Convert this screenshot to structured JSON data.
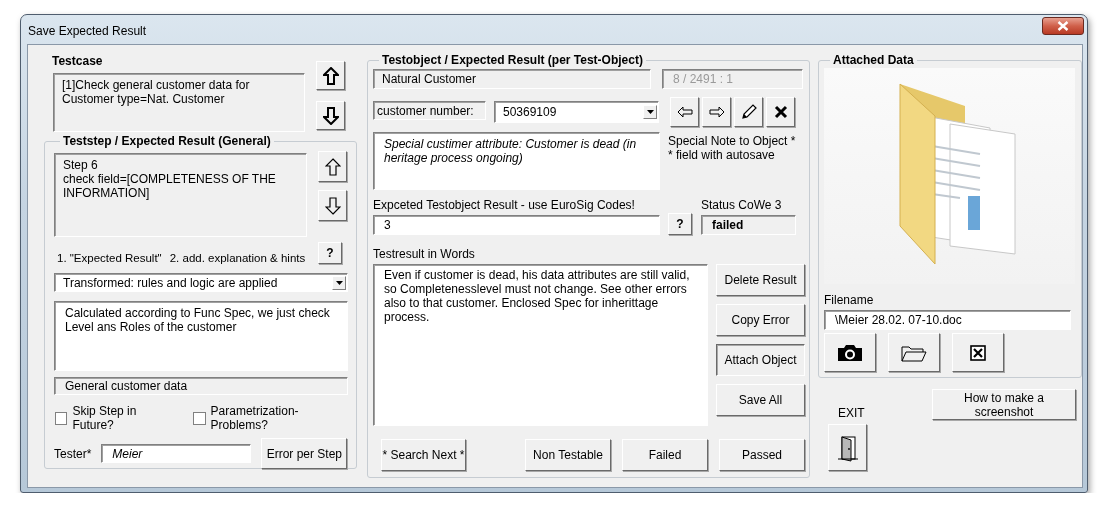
{
  "window": {
    "title": "Save Expected Result"
  },
  "testcase": {
    "label": "Testcase",
    "text": "[1]Check general customer data for Customer type=Nat. Customer"
  },
  "teststep": {
    "label": "Teststep / Expected Result (General)",
    "text": "Step 6\ncheck field=[COMPLETENESS OF THE INFORMATION]",
    "hints": [
      "1.  \"Expected Result\"",
      "2. add. explanation & hints"
    ],
    "help_button": "?",
    "category": "Transformed: rules and logic are applied",
    "explanation": "Calculated according to Func Spec, we just check Level ans Roles of the customer",
    "group": "General customer data",
    "checkboxes": [
      {
        "label": "Skip Step in Future?",
        "checked": false
      },
      {
        "label": "Parametrization-Problems?",
        "checked": false
      }
    ],
    "tester_label": "Tester*",
    "tester": "Meier",
    "error_button": "Error per Step"
  },
  "testobject": {
    "label": "Testobject  / Expected Result (per Test-Object)",
    "type": "Natural Customer",
    "position": {
      "text": "8 / 2491 : 1",
      "disabled": true
    },
    "key_label": "customer number:",
    "key_value": "50369109",
    "note": "Special custimer attribute: Customer is dead (in heritage process ongoing)",
    "note_hints": [
      "Special Note to Object *",
      "* field with autosave"
    ],
    "expected_label": "Expceted Testobject Result - use EuroSig Codes!",
    "expected": "3",
    "help_button": "?",
    "status_label": "Status CoWe 3",
    "status": "failed",
    "words_label": "Testresult in Words",
    "words": "Even if customer is dead, his data attributes are still valid, so Completenesslevel must not change. See other errors also to that customer. Enclosed Spec for inherittage process.",
    "side_buttons": [
      {
        "label": "Delete Result",
        "pressed": false
      },
      {
        "label": "Copy Error",
        "pressed": false
      },
      {
        "label": "Attach Object",
        "pressed": true
      },
      {
        "label": "Save All",
        "pressed": false
      }
    ],
    "bottom_buttons": [
      "* Search Next *",
      "Non Testable",
      "Failed",
      "Passed"
    ]
  },
  "attached": {
    "label": "Attached Data",
    "filename_label": "Filename",
    "filename": "\\Meier 28.02. 07-10.doc"
  },
  "exit_label": "EXIT",
  "screenshot_button": "How to make a screenshot"
}
